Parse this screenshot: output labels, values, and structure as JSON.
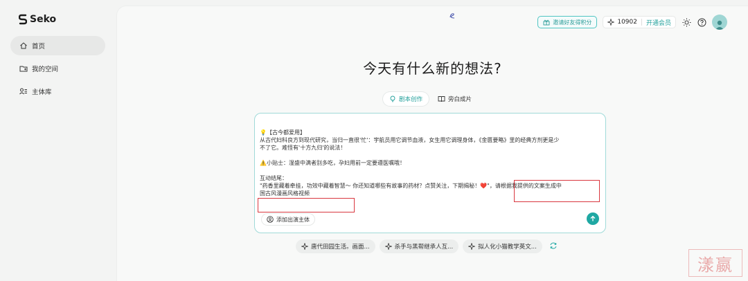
{
  "brand": {
    "name": "Seko"
  },
  "sidebar": {
    "items": [
      {
        "label": "首页",
        "icon": "home-icon",
        "active": true
      },
      {
        "label": "我的空间",
        "icon": "folder-icon",
        "active": false
      },
      {
        "label": "主体库",
        "icon": "people-list-icon",
        "active": false
      }
    ]
  },
  "topbar": {
    "invite_label": "邀请好友得积分",
    "points_value": "10902",
    "vip_label": "开通会员"
  },
  "main": {
    "title": "今天有什么新的想法?",
    "tabs": [
      {
        "label": "剧本创作",
        "icon": "lightbulb-icon",
        "active": true
      },
      {
        "label": "旁白成片",
        "icon": "book-icon",
        "active": false
      }
    ]
  },
  "editor": {
    "lines": [
      "💡【古今都爱用】",
      "从古代妇科良方到现代研究，当归一直很'忙'：宇航员用它调节血液，女生用它调理身体，《金匮要略》里的经典方剂更是少",
      "不了它。难怪有'十方九归'的说法！",
      "",
      "⚠️小贴士：湿盛中满者别多吃，孕妇用前一定要遵医嘱哦！",
      "",
      "互动结尾：",
      "\"药香里藏着牵挂，功效中藏着智慧～ 你还知道哪些有故事的药材？点赞关注，下期揭秘！❤️\"，请根据我提供的文案生成中",
      "国古风漫画风格视频"
    ],
    "add_entity_label": "添加出演主体"
  },
  "suggestions": [
    {
      "label": "唐代田园生活。画面..."
    },
    {
      "label": "杀手与黑帮继承人互..."
    },
    {
      "label": "拟人化小猫教学英文..."
    }
  ],
  "watermark": {
    "text": "漾嬴"
  },
  "colors": {
    "accent": "#1fa8a3",
    "highlight": "#d9363e"
  }
}
